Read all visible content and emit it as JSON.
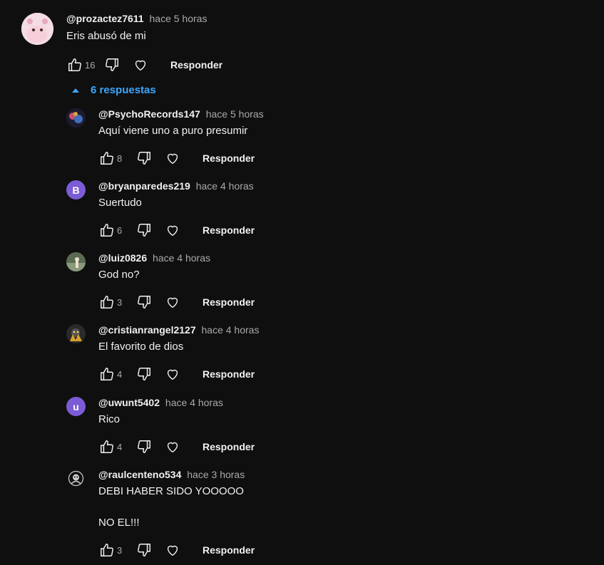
{
  "top_comment": {
    "author": "@prozactez7611",
    "time": "hace 5 horas",
    "text": "Eris abusó de mi",
    "likes": "16",
    "reply_label": "Responder"
  },
  "replies_toggle": {
    "label": "6 respuestas"
  },
  "replies": [
    {
      "author": "@PsychoRecords147",
      "time": "hace 5 horas",
      "text": "Aquí viene uno a puro presumir",
      "likes": "8",
      "reply_label": "Responder",
      "avatar_letter": ""
    },
    {
      "author": "@bryanparedes219",
      "time": "hace 4 horas",
      "text": "Suertudo",
      "likes": "6",
      "reply_label": "Responder",
      "avatar_letter": "B"
    },
    {
      "author": "@luiz0826",
      "time": "hace 4 horas",
      "text": "God no?",
      "likes": "3",
      "reply_label": "Responder",
      "avatar_letter": ""
    },
    {
      "author": "@cristianrangel2127",
      "time": "hace 4 horas",
      "text": "El favorito de dios",
      "likes": "4",
      "reply_label": "Responder",
      "avatar_letter": ""
    },
    {
      "author": "@uwunt5402",
      "time": "hace 4 horas",
      "text": "Rico",
      "likes": "4",
      "reply_label": "Responder",
      "avatar_letter": "u"
    },
    {
      "author": "@raulcenteno534",
      "time": "hace 3 horas",
      "text": "DEBI HABER SIDO YOOOOO\n\nNO EL!!!",
      "likes": "3",
      "reply_label": "Responder",
      "avatar_letter": ""
    }
  ],
  "colors": {
    "background": "#0f0f0f",
    "link": "#3ea6ff",
    "secondary_text": "#aaaaaa",
    "letter_avatar": "#7b5cd6"
  }
}
